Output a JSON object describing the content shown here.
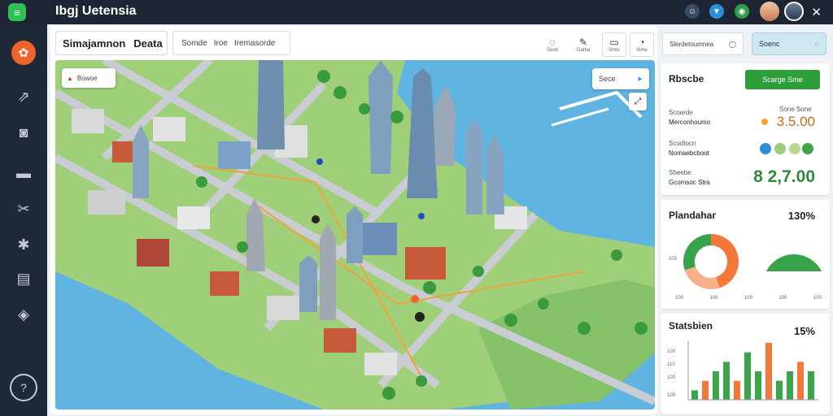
{
  "app": {
    "title": "Ibgj Uetensia"
  },
  "toolbar": {
    "title": "Simajamnon",
    "title_tab": "Deata",
    "tabs": [
      "Somde",
      "Iroe",
      "Iremasorde"
    ],
    "tools": [
      {
        "icon": "pin-icon",
        "label": "Soob"
      },
      {
        "icon": "pen-icon",
        "label": "Gatha"
      },
      {
        "icon": "layers-icon",
        "label": "Shbs"
      },
      {
        "icon": "pin-outline-icon",
        "label": "Sime"
      }
    ]
  },
  "map": {
    "chip_label": "Bowoe",
    "search_label": "Sece"
  },
  "right": {
    "search_box": "Slerdetoumnea",
    "search_button": "Soenc",
    "card1": {
      "title": "Rbscbe",
      "button": "Scarge Sme",
      "line1_label": "Scoarde",
      "line1_sub": "Merconhoumo",
      "line1_right_label": "Sone Sone",
      "line1_value": "3.5.00",
      "line2_label": "Scodtocn",
      "line2_sub": "Nomaebcboot",
      "line3_label": "Sheebe",
      "line3_sub": "Gcomsoc Stra",
      "line3_value": "8 2,7.00",
      "dot_colors": [
        "#2f8fd6",
        "#9ccd7c",
        "#b8d88f",
        "#3fa34a"
      ]
    },
    "card2": {
      "title": "Plandahar",
      "percent": "130%",
      "axis_labels": [
        "100",
        "100",
        "100",
        "100",
        "100"
      ],
      "side_label": "103"
    },
    "card3": {
      "title": "Statsbien",
      "percent": "15%",
      "y_ticks": [
        "100",
        "110",
        "100",
        "100"
      ]
    }
  },
  "chart_data": [
    {
      "type": "pie",
      "title": "Plandahar",
      "values": [
        45,
        25,
        30
      ],
      "colors": [
        "#f2793b",
        "#f7b08a",
        "#37a34a"
      ]
    },
    {
      "type": "bar",
      "title": "Statsbien",
      "series": [
        {
          "values": [
            1,
            2,
            3,
            4,
            2,
            5,
            3,
            6,
            2,
            3,
            4,
            3
          ]
        }
      ],
      "colors": [
        "#3aa54a",
        "#f2793b"
      ]
    }
  ],
  "colors": {
    "topbar": "#1d2535",
    "sidebar": "#1f2838",
    "accent_orange": "#f0642a",
    "accent_green": "#2e9e3b",
    "water": "#5fb4e2",
    "land": "#9fcf79"
  }
}
